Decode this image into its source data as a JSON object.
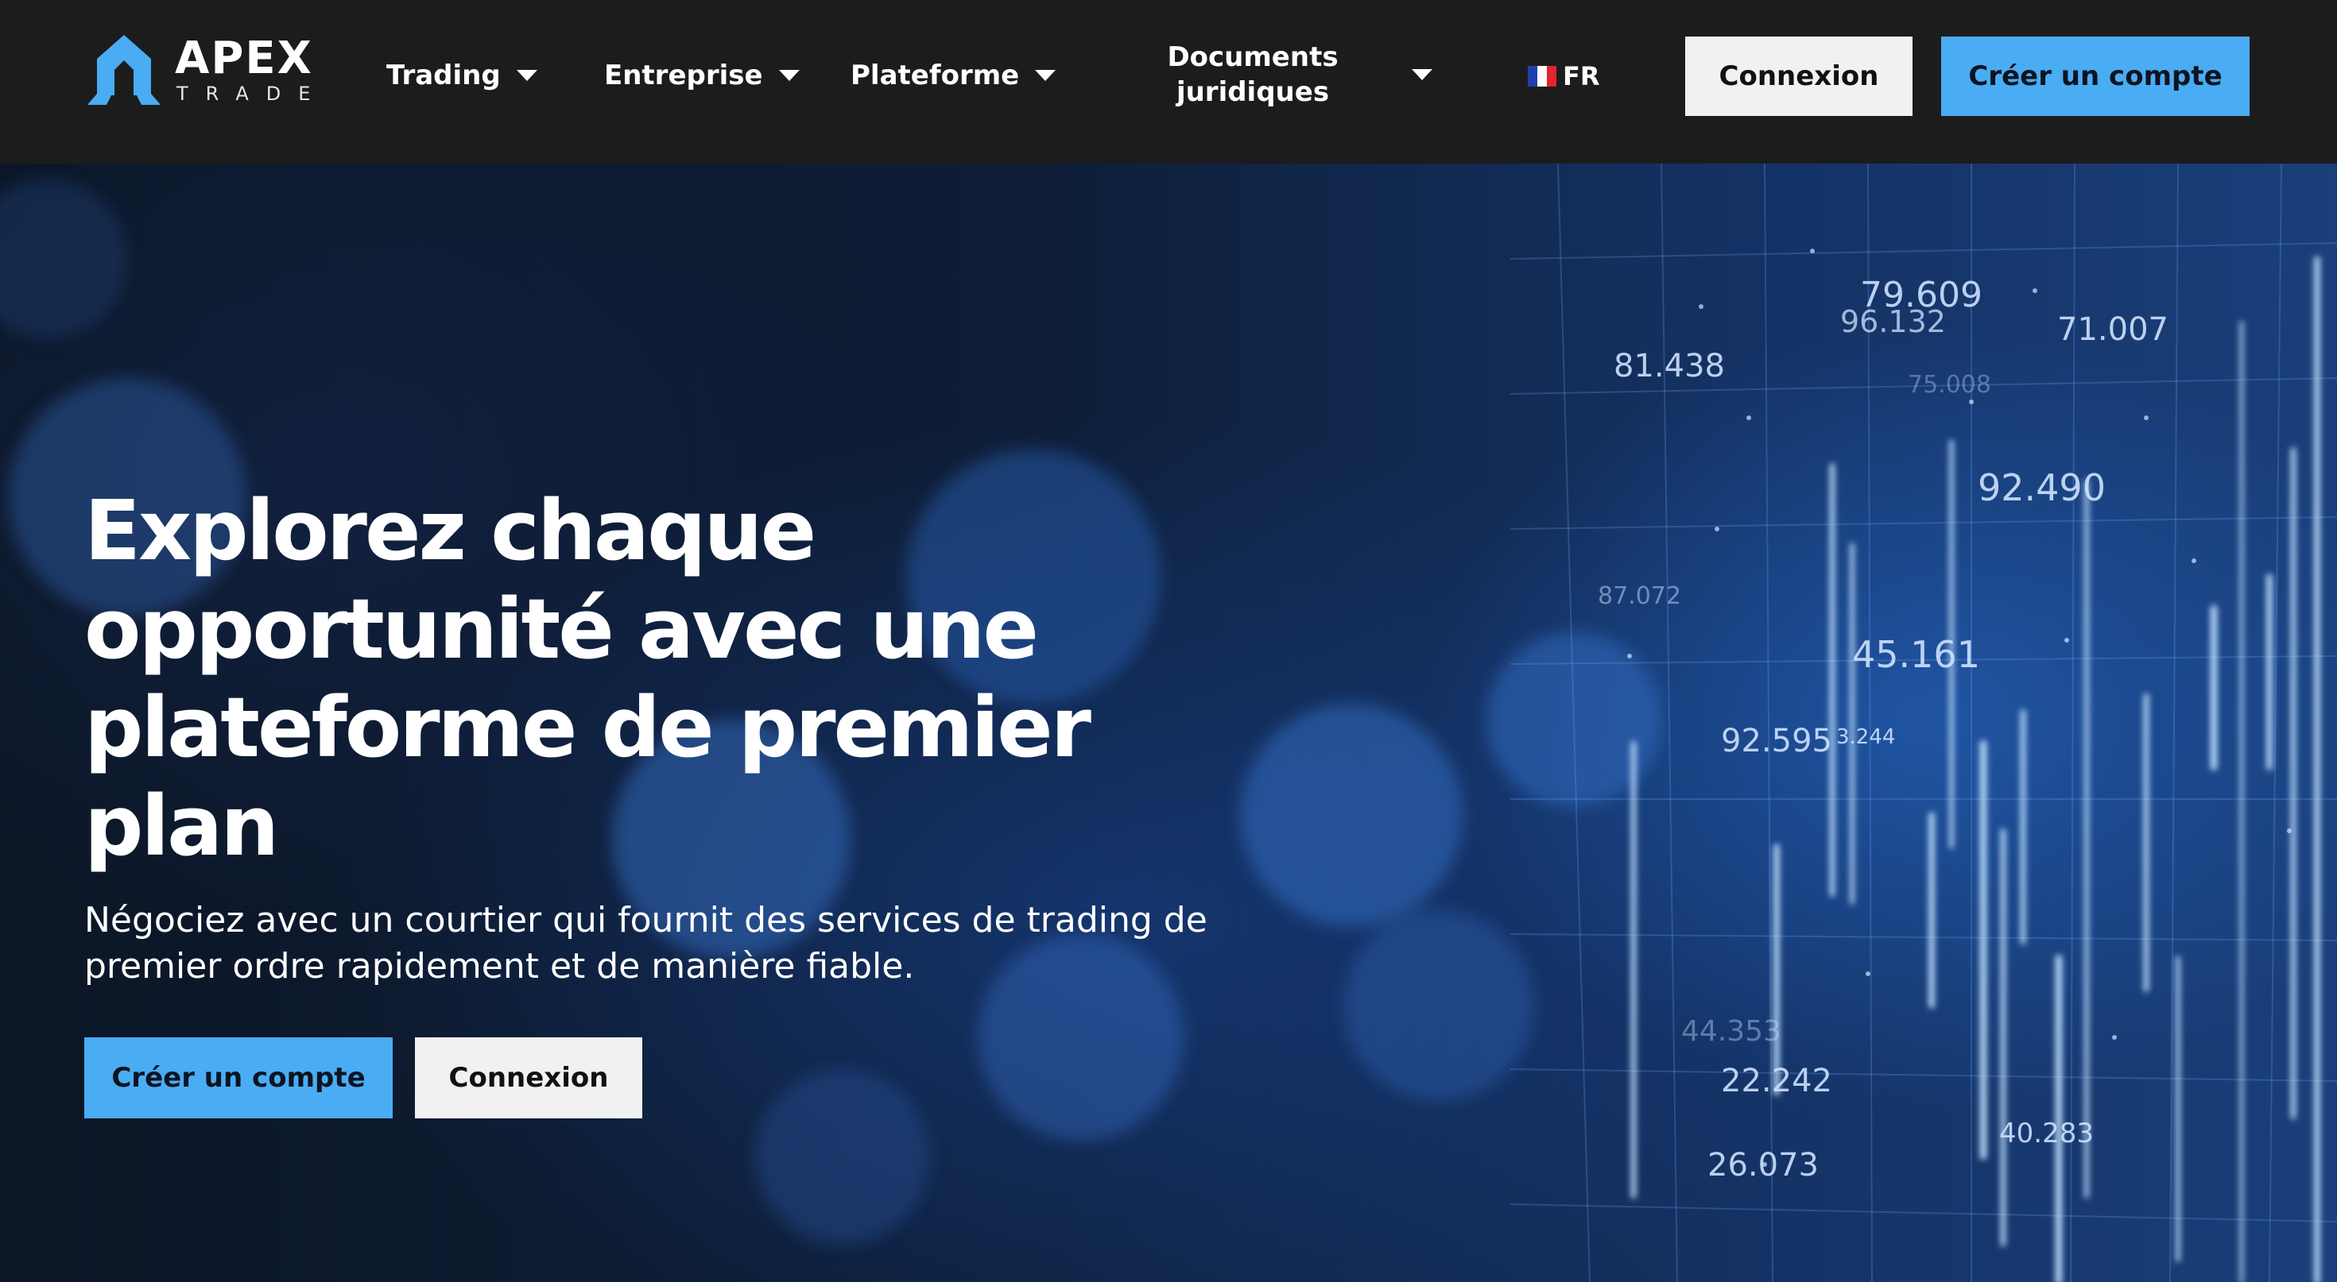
{
  "brand": {
    "name": "APEX",
    "tagline": "TRADE"
  },
  "nav": {
    "items": [
      {
        "label": "Trading"
      },
      {
        "label": "Entreprise"
      },
      {
        "label": "Plateforme"
      },
      {
        "label": "Documents juridiques"
      }
    ],
    "language": {
      "code": "FR",
      "flag_colors": [
        "#1f3fb0",
        "#ffffff",
        "#e0262e"
      ]
    }
  },
  "header_buttons": {
    "login": "Connexion",
    "signup": "Créer un compte"
  },
  "hero": {
    "title": "Explorez chaque opportunité avec une plateforme de premier plan",
    "subtitle": "Négociez avec un courtier qui fournit des services de trading de premier ordre rapidement et de manière fiable.",
    "primary_cta": "Créer un compte",
    "secondary_cta": "Connexion",
    "background_numbers": [
      "79.609",
      "96.132",
      "71.007",
      "81.438",
      "75.008",
      "92.490",
      "87.072",
      "45.161",
      "92.595",
      "3.244",
      "44.353",
      "22.242",
      "26.073",
      "40.283"
    ]
  },
  "colors": {
    "accent": "#4aacf3",
    "header_bg": "#1c1c1d",
    "light_button": "#f1f1f1"
  }
}
